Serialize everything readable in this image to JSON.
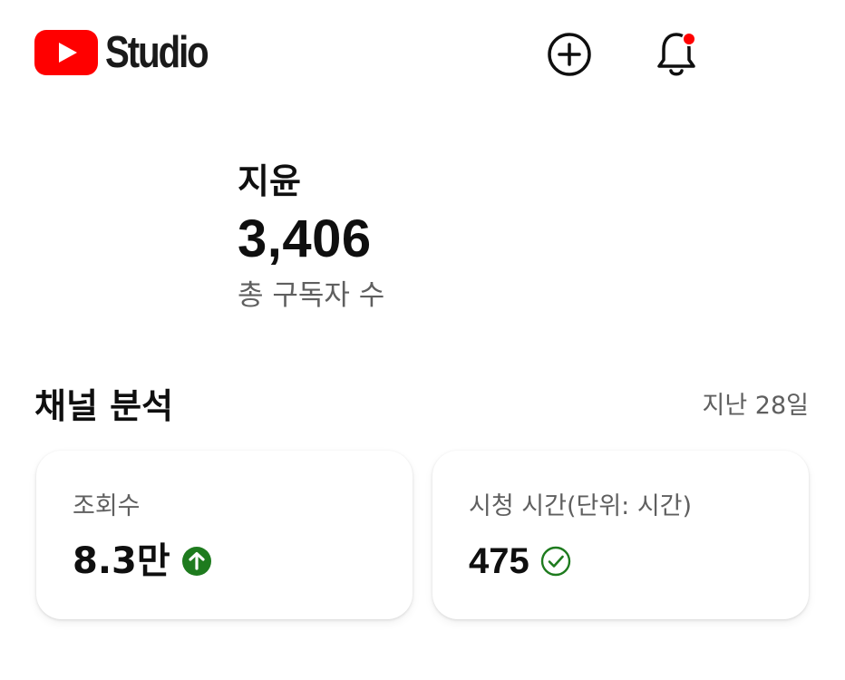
{
  "header": {
    "logo_text": "Studio",
    "logo_icon": "youtube-play-icon",
    "create_icon": "add-circle-icon",
    "notification_icon": "bell-icon",
    "notification_dot_color": "#ff0000",
    "brand_color": "#ff0000"
  },
  "channel": {
    "name": "지윤",
    "subscriber_count": "3,406",
    "subscriber_label": "총 구독자 수"
  },
  "analytics": {
    "title": "채널 분석",
    "period": "지난 28일",
    "cards": [
      {
        "label": "조회수",
        "value": "8.3만",
        "indicator_icon": "arrow-up-circle-icon",
        "indicator_color": "#1e7b1e"
      },
      {
        "label": "시청 시간(단위: 시간)",
        "value": "475",
        "indicator_icon": "check-circle-icon",
        "indicator_color": "#1e7b1e"
      }
    ]
  }
}
